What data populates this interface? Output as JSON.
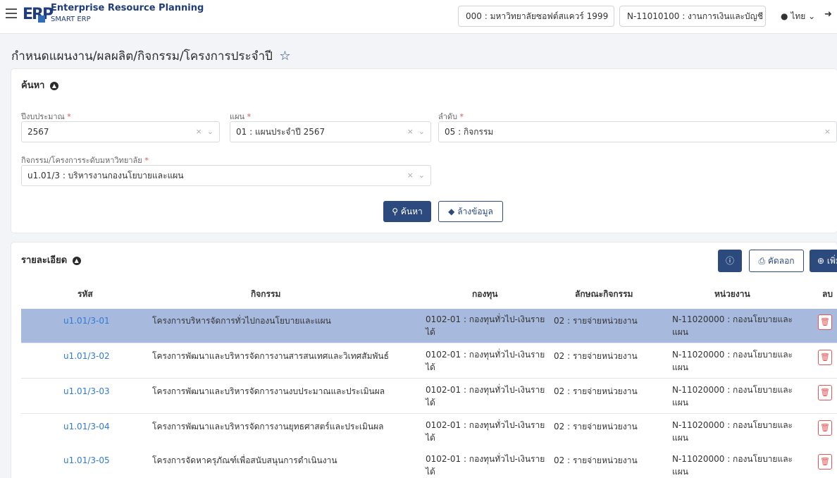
{
  "header": {
    "app_title": "Enterprise Resource Planning",
    "app_subtitle": "SMART ERP",
    "logo_text": "ERP",
    "org_selector": "000 : มหาวิทยาลัยซอฟต์สแควร์ 1999",
    "dept_selector": "N-11010100 : งานการเงินและบัญชี",
    "language": "ไทย"
  },
  "page": {
    "title": "กำหนดแผนงาน/ผลผลิต/กิจกรรม/โครงการประจำปี"
  },
  "search": {
    "heading": "ค้นหา",
    "fiscal_year": {
      "label": "ปีงบประมาณ",
      "value": "2567"
    },
    "plan": {
      "label": "แผน",
      "value": "01 : แผนประจำปี 2567"
    },
    "order": {
      "label": "ลำดับ",
      "value": "05 : กิจกรรม"
    },
    "activity": {
      "label": "กิจกรรม/โครงการระดับมหาวิทยาลัย",
      "value": "u1.01/3 : บริหารงานกองนโยบายและแผน"
    },
    "search_button": "ค้นหา",
    "clear_button": "ล้างข้อมูล"
  },
  "detail": {
    "heading": "รายละเอียด",
    "copy_button": "คัดลอก",
    "add_button": "เพิ่ม",
    "columns": [
      "รหัส",
      "กิจกรรม",
      "กองทุน",
      "ลักษณะกิจกรรม",
      "หน่วยงาน",
      "ลบ"
    ],
    "rows": [
      {
        "code": "u1.01/3-01",
        "activity": "โครงการบริหารจัดการทั่วไปกองนโยบายและแผน",
        "fund_1": "0102-01 : กองทุนทั่วไป-เงินราย",
        "fund_2": "ได้",
        "type": "02 : รายจ่ายหน่วยงาน",
        "unit_1": "N-11020000 : กองนโยบายและ",
        "unit_2": "แผน",
        "selected": true
      },
      {
        "code": "u1.01/3-02",
        "activity": "โครงการพัฒนาและบริหารจัดการงานสารสนเทศและวิเทศสัมพันธ์",
        "fund_1": "0102-01 : กองทุนทั่วไป-เงินราย",
        "fund_2": "ได้",
        "type": "02 : รายจ่ายหน่วยงาน",
        "unit_1": "N-11020000 : กองนโยบายและ",
        "unit_2": "แผน",
        "selected": false
      },
      {
        "code": "u1.01/3-03",
        "activity": "โครงการพัฒนาและบริหารจัดการงานงบประมาณและประเมินผล",
        "fund_1": "0102-01 : กองทุนทั่วไป-เงินราย",
        "fund_2": "ได้",
        "type": "02 : รายจ่ายหน่วยงาน",
        "unit_1": "N-11020000 : กองนโยบายและ",
        "unit_2": "แผน",
        "selected": false
      },
      {
        "code": "u1.01/3-04",
        "activity": "โครงการพัฒนาและบริหารจัดการงานยุทธศาสตร์และประเมินผล",
        "fund_1": "0102-01 : กองทุนทั่วไป-เงินราย",
        "fund_2": "ได้",
        "type": "02 : รายจ่ายหน่วยงาน",
        "unit_1": "N-11020000 : กองนโยบายและ",
        "unit_2": "แผน",
        "selected": false
      },
      {
        "code": "u1.01/3-05",
        "activity": "โครงการจัดหาครุภัณฑ์เพื่อสนับสนุนการดำเนินงาน",
        "fund_1": "0102-01 : กองทุนทั่วไป-เงินราย",
        "fund_2": "ได้",
        "type": "02 : รายจ่ายหน่วยงาน",
        "unit_1": "N-11020000 : กองนโยบายและ",
        "unit_2": "แผน",
        "selected": false
      }
    ]
  },
  "colors": {
    "primary": "#2c4a7e",
    "selected_row": "#a8b9de",
    "link": "#2f7bd6",
    "danger": "#e05656"
  }
}
